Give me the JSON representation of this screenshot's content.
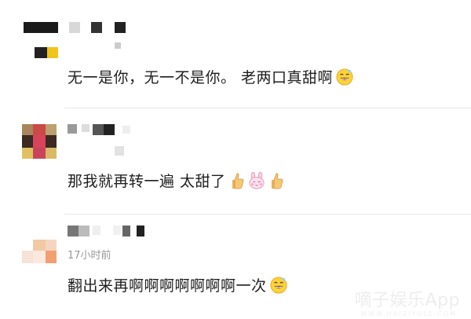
{
  "comments": [
    {
      "time": "",
      "text": "无一是你，无一不是你。 老两口真甜啊",
      "emojis": [
        "grin-emoji"
      ]
    },
    {
      "time": "",
      "text": "那我就再转一遍 太甜了",
      "emojis": [
        "thumbs-up-icon",
        "bunny-emoji",
        "thumbs-up-icon"
      ]
    },
    {
      "time": "17小时前",
      "text": "翻出来再啊啊啊啊啊啊啊一次",
      "emojis": [
        "grin-emoji"
      ]
    }
  ],
  "watermark": {
    "text": "嘀子娱乐App",
    "sub": "WWW.HAIZIYULE.COM"
  }
}
